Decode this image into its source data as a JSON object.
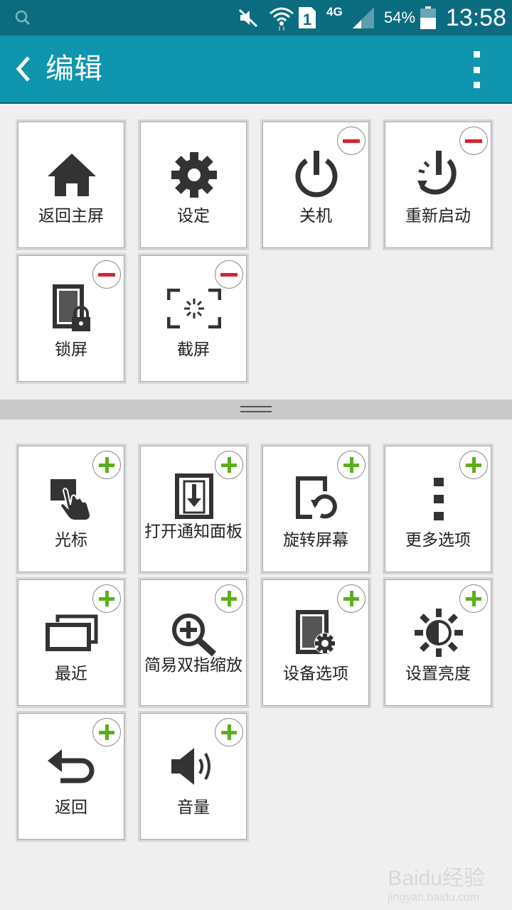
{
  "status_bar": {
    "time": "13:58",
    "battery": "54%",
    "network": "4G",
    "sim": "1",
    "icons": [
      "search-icon",
      "mute-icon",
      "wifi-icon",
      "sim-icon",
      "signal-icon",
      "battery-icon"
    ]
  },
  "header": {
    "title": "编辑",
    "back_icon": "chevron-left-icon",
    "menu_icon": "more-vertical-icon",
    "background": "#0f95ad"
  },
  "active_items": [
    {
      "label": "返回主屏",
      "icon": "home-icon"
    },
    {
      "label": "设定",
      "icon": "gear-icon"
    },
    {
      "label": "关机",
      "icon": "power-icon",
      "action": "remove"
    },
    {
      "label": "重新启动",
      "icon": "restart-icon",
      "action": "remove"
    },
    {
      "label": "锁屏",
      "icon": "lock-screen-icon",
      "action": "remove"
    },
    {
      "label": "截屏",
      "icon": "screenshot-icon",
      "action": "remove"
    }
  ],
  "available_items": [
    {
      "label": "光标",
      "icon": "cursor-hand-icon",
      "action": "add"
    },
    {
      "label": "打开通知面板",
      "icon": "notification-panel-icon",
      "action": "add"
    },
    {
      "label": "旋转屏幕",
      "icon": "rotate-screen-icon",
      "action": "add"
    },
    {
      "label": "更多选项",
      "icon": "more-options-icon",
      "action": "add"
    },
    {
      "label": "最近",
      "icon": "recent-apps-icon",
      "action": "add"
    },
    {
      "label": "简易双指缩放",
      "icon": "zoom-icon",
      "action": "add"
    },
    {
      "label": "设备选项",
      "icon": "device-options-icon",
      "action": "add"
    },
    {
      "label": "设置亮度",
      "icon": "brightness-icon",
      "action": "add"
    },
    {
      "label": "返回",
      "icon": "back-arrow-icon",
      "action": "add"
    },
    {
      "label": "音量",
      "icon": "volume-icon",
      "action": "add"
    }
  ],
  "colors": {
    "remove": "#d8232a",
    "add": "#5cae1e",
    "status_bar": "#0b6c80"
  },
  "watermark": {
    "text": "Baidu经验",
    "sub": "jingyan.baidu.com"
  }
}
